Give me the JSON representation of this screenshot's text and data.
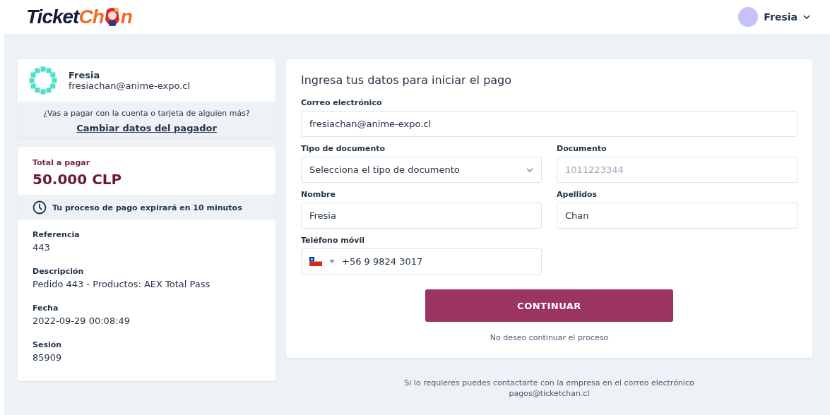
{
  "header": {
    "logo": {
      "part_1": "Ticket",
      "part_2": "Ch",
      "part_3": "n"
    },
    "user": {
      "name": "Fresia"
    }
  },
  "payer": {
    "name": "Fresia",
    "email": "fresiachan@anime-expo.cl",
    "question": "¿Vas a pagar con la cuenta o tarjeta de alguien más?",
    "change_link": "Cambiar datos del pagador"
  },
  "summary": {
    "total_label": "Total a pagar",
    "total": "50.000 CLP",
    "timer": "Tu proceso de pago expirará en 10 minutos",
    "details": [
      {
        "label": "Referencia",
        "value": "443"
      },
      {
        "label": "Descripción",
        "value": "Pedido 443 - Productos: AEX Total Pass"
      },
      {
        "label": "Fecha",
        "value": "2022-09-29 00:08:49"
      },
      {
        "label": "Sesión",
        "value": "85909"
      }
    ]
  },
  "form": {
    "title": "Ingresa tus datos para iniciar el pago",
    "rows": [
      [
        {
          "kind": "input",
          "label": "Correo electrónico",
          "value": "fresiachan@anime-expo.cl"
        }
      ],
      [
        {
          "kind": "select",
          "label": "Tipo de documento",
          "value": "Selecciona el tipo de documento"
        },
        {
          "kind": "input",
          "label": "Documento",
          "placeholder": "1011223344"
        }
      ],
      [
        {
          "kind": "input",
          "label": "Nombre",
          "value": "Fresia"
        },
        {
          "kind": "input",
          "label": "Apellidos",
          "value": "Chan"
        }
      ],
      [
        {
          "kind": "phone",
          "label": "Teléfono móvil",
          "value": "+56 9 9824 3017"
        }
      ]
    ],
    "submit": "CONTINUAR",
    "cancel": "No deseo continuar el proceso"
  },
  "footer": {
    "line_1": "Si lo requieres puedes contactarte con la empresa en el correo electrónico",
    "line_2": "pagos@ticketchan.cl"
  }
}
